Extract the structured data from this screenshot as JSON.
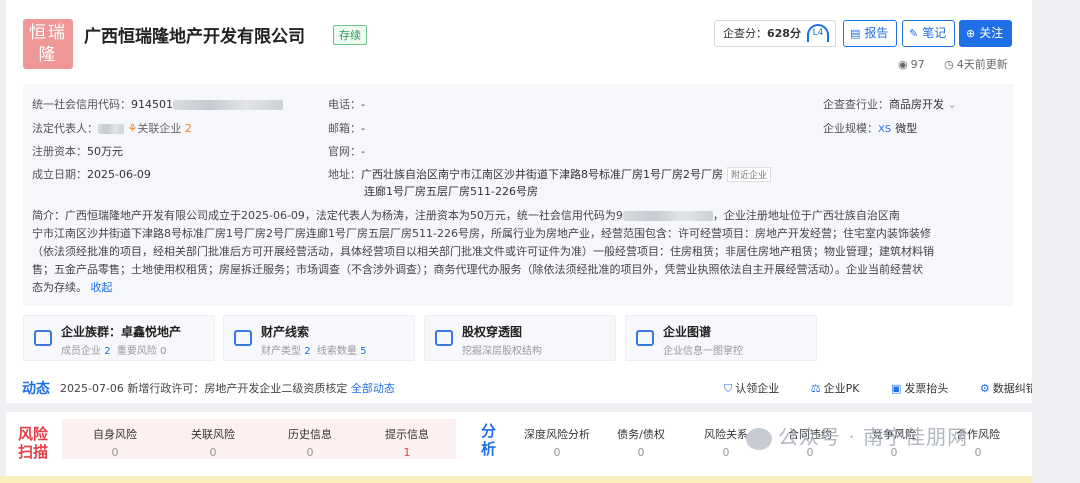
{
  "company": {
    "logo_text": "恒瑞隆",
    "name": "广西恒瑞隆地产开发有限公司",
    "status": "存续",
    "score_label": "企查分：",
    "score_value": "628分",
    "gauge_text": "L4",
    "buttons": {
      "report": "报告",
      "note": "笔记",
      "follow": "关注"
    },
    "views": "97",
    "updated": "4天前更新"
  },
  "info": {
    "credit_code_label": "统一社会信用代码：",
    "credit_code_prefix": "914501",
    "legal_rep_label": "法定代表人：",
    "related_label": "关联企业",
    "related_count": "2",
    "capital_label": "注册资本：",
    "capital_value": "50万元",
    "date_label": "成立日期：",
    "date_value": "2025-06-09",
    "phone_label": "电话：",
    "phone_value": "-",
    "email_label": "邮箱：",
    "email_value": "-",
    "web_label": "官网：",
    "web_value": "-",
    "address_label": "地址：",
    "address_line1": "广西壮族自治区南宁市江南区沙井街道下津路8号标准厂房1号厂房2号厂房",
    "address_line2": "连廊1号厂房五层厂房511-226号房",
    "nearby_label": "附近企业",
    "industry_label": "企查查行业：",
    "industry_value": "商品房开发",
    "scale_label": "企业规模：",
    "scale_badge": "XS",
    "scale_value": "微型"
  },
  "intro": {
    "line1a": "简介：广西恒瑞隆地产开发有限公司成立于2025-06-09，法定代表人为杨涛，注册资本为50万元，统一社会信用代码为9",
    "line1b": "，企业注册地址位于广西壮族自治区南",
    "line2": "宁市江南区沙井街道下津路8号标准厂房1号厂房2号厂房连廊1号厂房五层厂房511-226号房，所属行业为房地产业，经营范围包含：许可经营项目：房地产开发经营；住宅室内装饰装修",
    "line3": "（依法须经批准的项目，经相关部门批准后方可开展经营活动，具体经营项目以相关部门批准文件或许可证件为准）一般经营项目：住房租赁；非居住房地产租赁；物业管理；建筑材料销",
    "line4": "售；五金产品零售；土地使用权租赁；房屋拆迁服务；市场调查（不含涉外调查）；商务代理代办服务（除依法须经批准的项目外，凭营业执照依法自主开展经营活动）。企业当前经营状",
    "line5": "态为存续。",
    "collapse": "收起"
  },
  "cards": [
    {
      "title": "企业族群：卓鑫悦地产",
      "sub1": "成员企业",
      "n1": "2",
      "sub2": "重要风险",
      "n2": "0"
    },
    {
      "title": "财产线索",
      "sub1": "财产类型",
      "n1": "2",
      "sub2": "线索数量",
      "n2": "5"
    },
    {
      "title": "股权穿透图",
      "sub1": "挖掘深层股权结构",
      "n1": "",
      "sub2": "",
      "n2": ""
    },
    {
      "title": "企业图谱",
      "sub1": "企业信息一图掌控",
      "n1": "",
      "sub2": "",
      "n2": ""
    }
  ],
  "dynamic": {
    "label": "动态",
    "text": "2025-07-06 新增行政许可：房地产开发企业二级资质核定",
    "all": "全部动态",
    "actions": [
      "认领企业",
      "企业PK",
      "发票抬头",
      "数据纠错"
    ]
  },
  "risk": {
    "label_top": "风险",
    "label_bottom": "扫描",
    "items": [
      {
        "label": "自身风险",
        "value": "0"
      },
      {
        "label": "关联风险",
        "value": "0"
      },
      {
        "label": "历史信息",
        "value": "0"
      },
      {
        "label": "提示信息",
        "value": "1"
      }
    ]
  },
  "analysis": {
    "label_top": "分",
    "label_bottom": "析",
    "items": [
      {
        "label": "深度风险分析",
        "value": "0"
      },
      {
        "label": "债务/债权",
        "value": "0"
      },
      {
        "label": "风险关系",
        "value": "0"
      },
      {
        "label": "合同违约",
        "value": "0"
      },
      {
        "label": "竞争风险",
        "value": "0"
      },
      {
        "label": "合作风险",
        "value": "0"
      }
    ]
  },
  "watermark": "公众号 · 南宁佳朋网"
}
